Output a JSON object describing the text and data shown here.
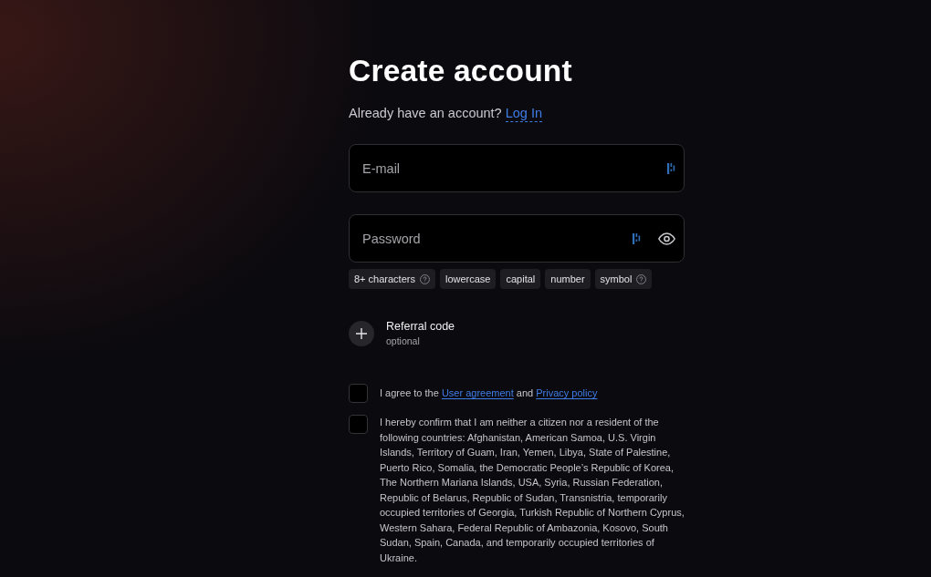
{
  "heading": "Create account",
  "login_prompt": {
    "text": "Already have an account?",
    "link": "Log In"
  },
  "fields": [
    {
      "kind": "email",
      "placeholder": "E-mail"
    },
    {
      "kind": "password",
      "placeholder": "Password"
    }
  ],
  "password_rules": [
    {
      "label": "8+ characters",
      "help": true
    },
    {
      "label": "lowercase",
      "help": false
    },
    {
      "label": "capital",
      "help": false
    },
    {
      "label": "number",
      "help": false
    },
    {
      "label": "symbol",
      "help": true
    }
  ],
  "referral": {
    "label": "Referral code",
    "note": "optional"
  },
  "consents": [
    {
      "checked": false,
      "parts": [
        {
          "kind": "text",
          "text": "I agree to the"
        },
        {
          "kind": "link",
          "text": "User agreement"
        },
        {
          "kind": "text",
          "text": "and"
        },
        {
          "kind": "link",
          "text": "Privacy policy"
        }
      ]
    },
    {
      "checked": false,
      "parts": [
        {
          "kind": "text",
          "text": "I hereby confirm that I am neither a citizen nor a resident of the following countries: Afghanistan, American Samoa, U.S. Virgin Islands, Territory of Guam, Iran, Yemen, Libya, State of Palestine, Puerto Rico, Somalia, the Democratic People’s Republic of Korea, The Northern Mariana Islands, USA, Syria, Russian Federation, Republic of Belarus, Republic of Sudan, Transnistria, temporarily occupied territories of Georgia, Turkish Republic of Northern Cyprus, Western Sahara, Federal Republic of Ambazonia, Kosovo, South Sudan, Spain, Canada, and temporarily occupied territories of Ukraine."
        }
      ]
    }
  ]
}
